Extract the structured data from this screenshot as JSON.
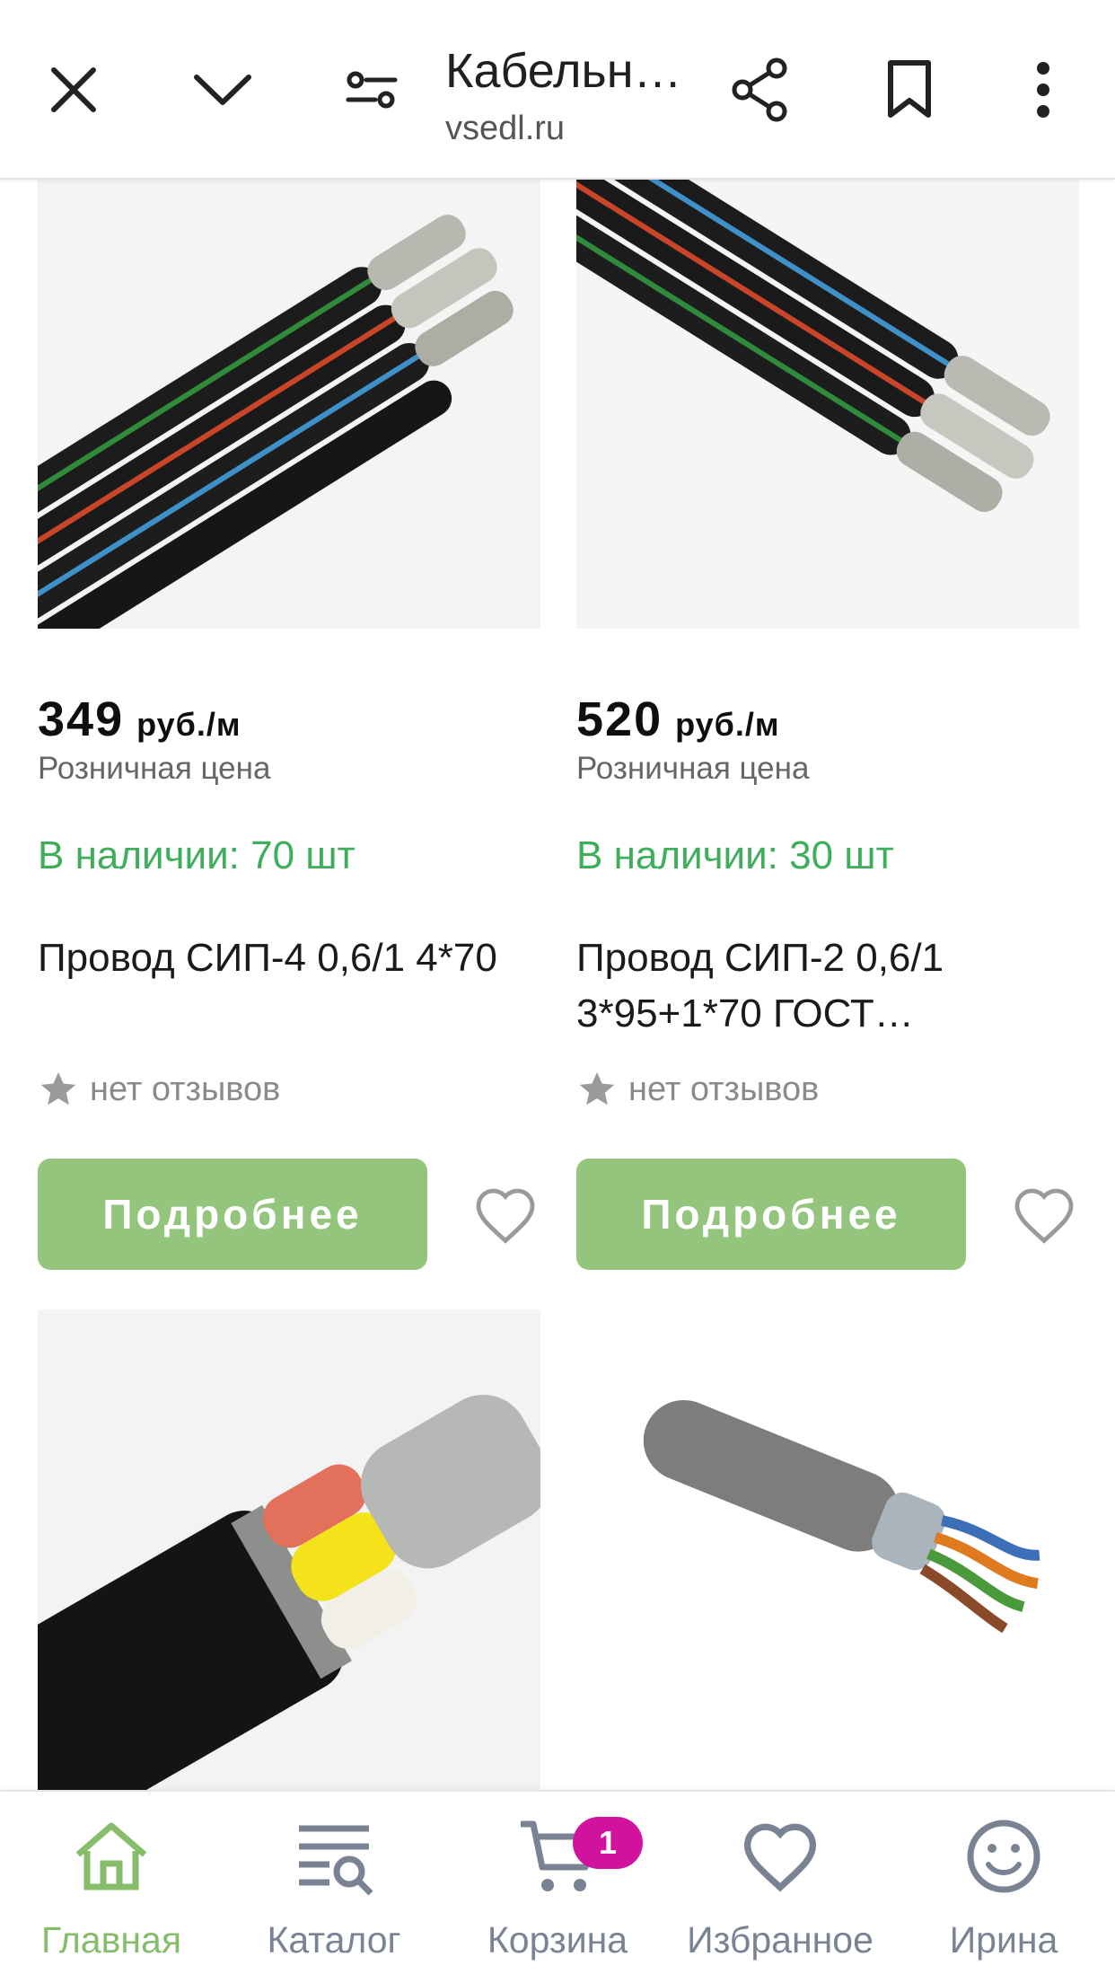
{
  "browser": {
    "title": "Кабельн…",
    "url": "vsedl.ru"
  },
  "colors": {
    "accent_green": "#93c57c",
    "stock_green": "#3fae5b",
    "badge_magenta": "#d1129f",
    "nav_gray": "#7a8394"
  },
  "products": [
    {
      "price": "349",
      "unit": "руб./м",
      "price_label": "Розничная цена",
      "stock": "В наличии: 70 шт",
      "name": "Провод СИП-4 0,6/1 4*70",
      "reviews": "нет отзывов",
      "button": "Подробнее",
      "image": "cable-sip4-icon"
    },
    {
      "price": "520",
      "unit": "руб./м",
      "price_label": "Розничная цена",
      "stock": "В наличии: 30 шт",
      "name": "Провод СИП-2 0,6/1 3*95+1*70 ГОСТ…",
      "reviews": "нет отзывов",
      "button": "Подробнее",
      "image": "cable-sip2-icon"
    },
    {
      "image": "armored-cable-icon"
    },
    {
      "image": "utp-cable-icon"
    }
  ],
  "nav": {
    "home": "Главная",
    "catalog": "Каталог",
    "cart": "Корзина",
    "cart_badge": "1",
    "favorites": "Избранное",
    "profile": "Ирина"
  }
}
